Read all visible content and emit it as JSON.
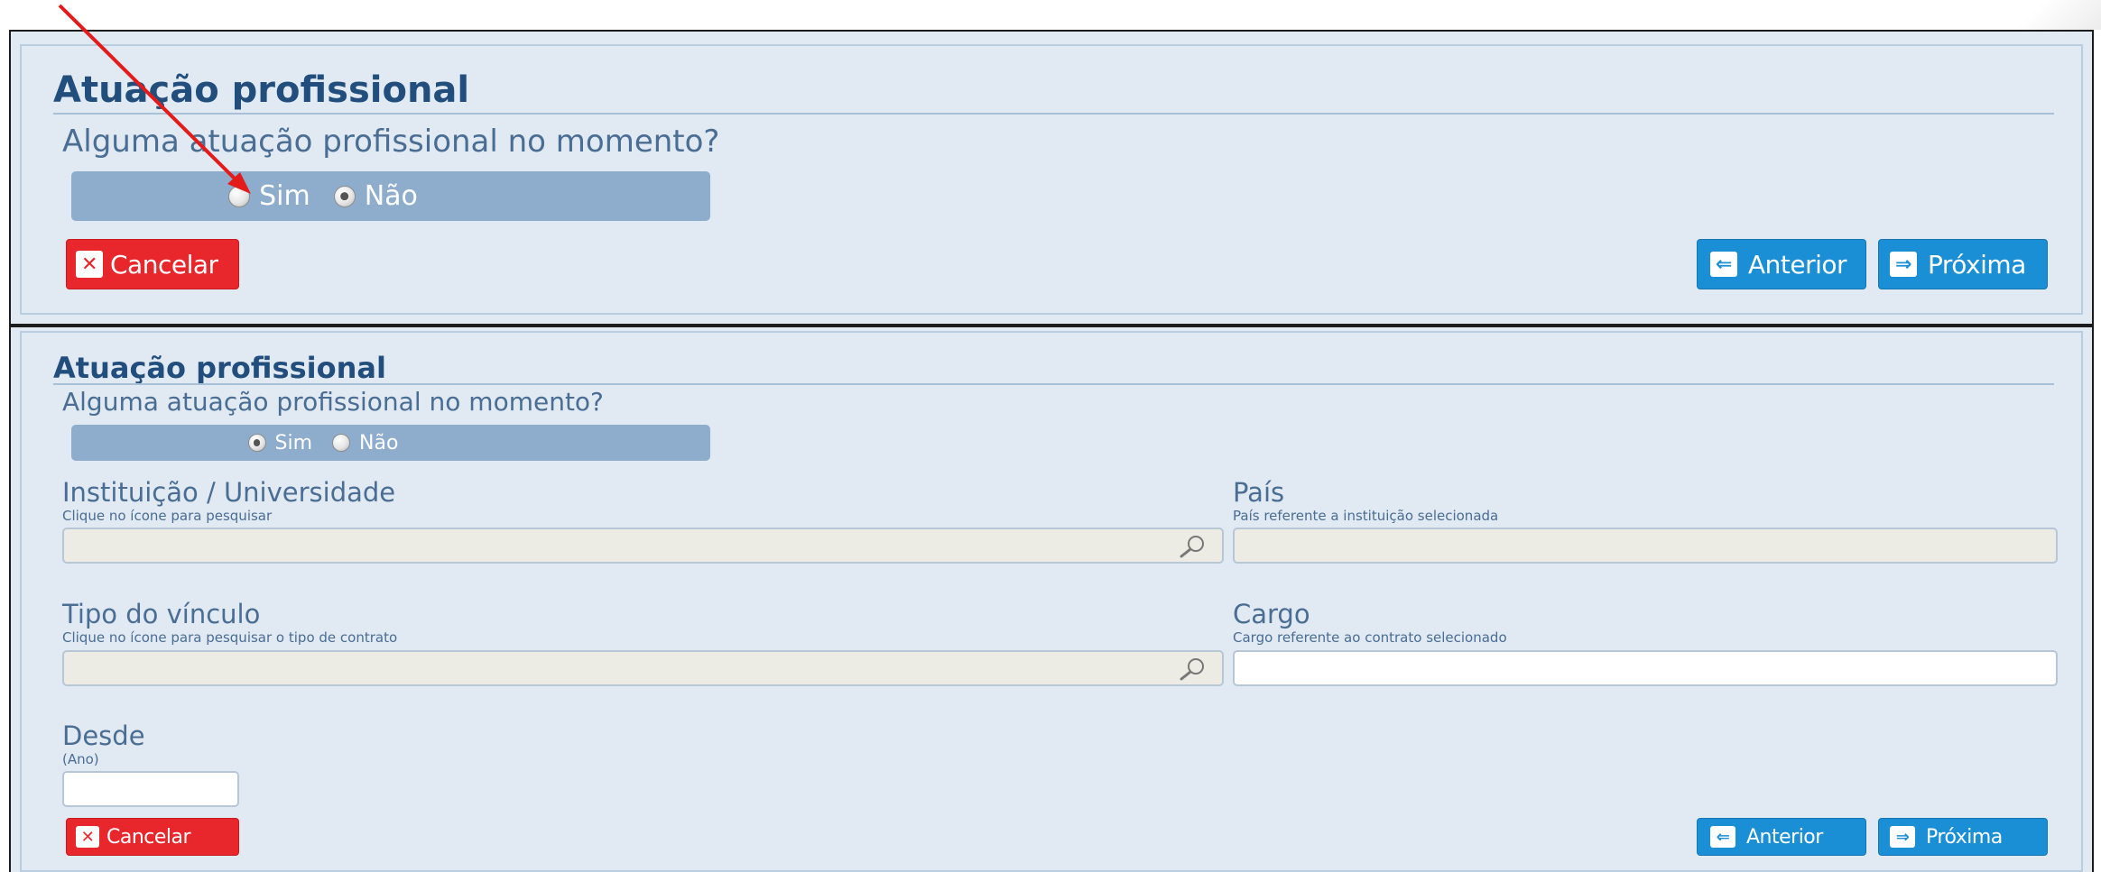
{
  "panel_top": {
    "title": "Atuação profissional",
    "question": "Alguma atuação profissional no momento?",
    "options": [
      "Sim",
      "Não"
    ],
    "selected": "Não",
    "cancel_label": "Cancelar",
    "prev_label": "Anterior",
    "next_label": "Próxima"
  },
  "panel_bottom": {
    "title": "Atuação profissional",
    "question": "Alguma atuação profissional no momento?",
    "options": [
      "Sim",
      "Não"
    ],
    "selected": "Sim",
    "instituicao": {
      "label": "Instituição / Universidade",
      "hint": "Clique no ícone para pesquisar",
      "value": ""
    },
    "pais": {
      "label": "País",
      "hint": "País referente a instituição selecionada",
      "value": ""
    },
    "tipo_vinculo": {
      "label": "Tipo do vínculo",
      "hint": "Clique no ícone para pesquisar o tipo de contrato",
      "value": ""
    },
    "cargo": {
      "label": "Cargo",
      "hint": "Cargo referente ao contrato selecionado",
      "value": ""
    },
    "desde": {
      "label": "Desde",
      "hint": "(Ano)",
      "value": ""
    },
    "cancel_label": "Cancelar",
    "prev_label": "Anterior",
    "next_label": "Próxima"
  },
  "icons": {
    "cancel": "close-icon",
    "prev": "arrow-left-icon",
    "next": "arrow-right-icon",
    "search": "magnifier-icon",
    "annotation": "red-arrow"
  },
  "colors": {
    "panel_bg": "#e1e9f3",
    "title": "#214e7c",
    "radio_bar": "#8eaccb",
    "cancel": "#e8272c",
    "nav": "#1b8fd6",
    "annotation_arrow": "#e31b1b"
  }
}
